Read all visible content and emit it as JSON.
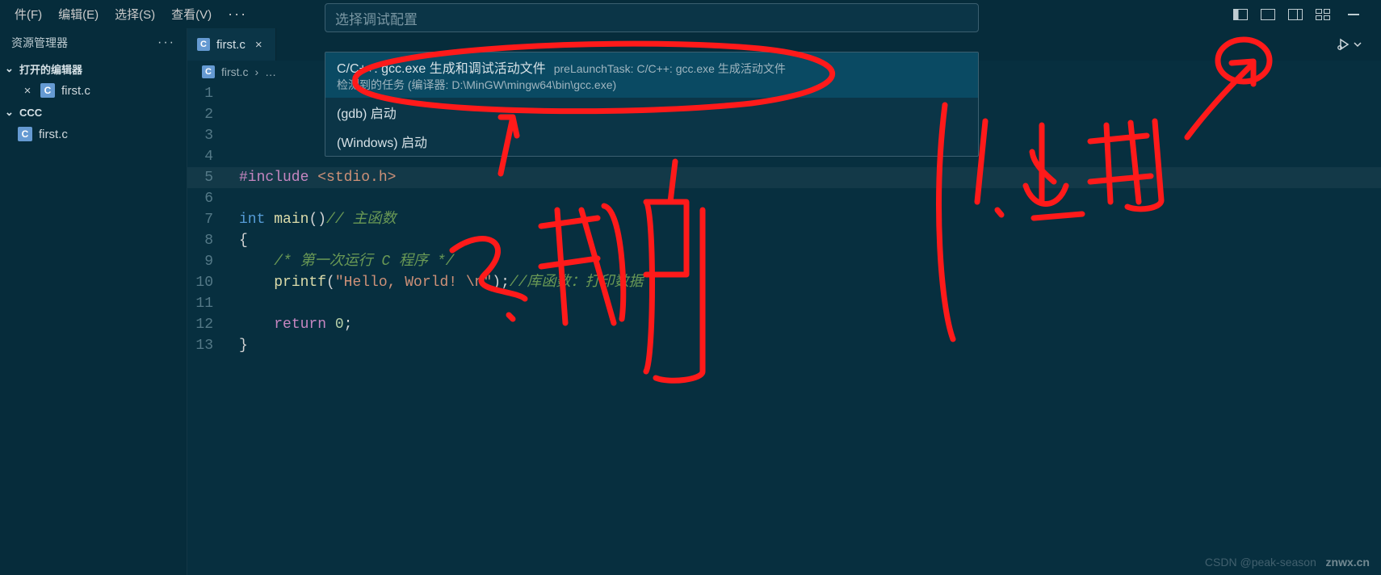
{
  "menubar": {
    "items": [
      "件(F)",
      "编辑(E)",
      "选择(S)",
      "查看(V)"
    ],
    "more": "···"
  },
  "title_controls": {
    "layouts": [
      "layout-left",
      "layout-bottom",
      "layout-right",
      "layout-grid"
    ],
    "minimize": "—"
  },
  "sidebar": {
    "title": "资源管理器",
    "more": "···",
    "open_editors_label": "打开的编辑器",
    "open_file": "first.c",
    "workspace_label": "CCC",
    "workspace_file": "first.c"
  },
  "tab": {
    "label": "first.c",
    "close": "×"
  },
  "run_button": {
    "icon": "debug-play-icon"
  },
  "breadcrumb": {
    "file": "first.c",
    "sep": "›",
    "more": "…"
  },
  "picker": {
    "placeholder": "选择调试配置",
    "items": [
      {
        "title": "C/C++: gcc.exe 生成和调试活动文件",
        "hint": "preLaunchTask: C/C++: gcc.exe 生成活动文件",
        "sub": "检测到的任务 (编译器: D:\\MinGW\\mingw64\\bin\\gcc.exe)"
      },
      {
        "title": "(gdb) 启动"
      },
      {
        "title": "(Windows) 启动"
      }
    ]
  },
  "editor_lines": [
    "1",
    "2",
    "3",
    "4",
    "5",
    "6",
    "7",
    "8",
    "9",
    "10",
    "11",
    "12",
    "13"
  ],
  "code": {
    "l5a": "#include ",
    "l5b": "<stdio.h>",
    "l7a": "int",
    "l7b": " ",
    "l7c": "main",
    "l7d": "()",
    "l7e": "// 主函数",
    "l8": "{",
    "l9": "    /* 第一次运行 C 程序 */",
    "l10a": "    ",
    "l10b": "printf",
    "l10c": "(",
    "l10d": "\"Hello, World! \\n\"",
    "l10e": ");",
    "l10f": "//库函数：打印数据",
    "l12a": "    ",
    "l12b": "return",
    "l12c": " ",
    "l12d": "0",
    "l12e": ";",
    "l13": "}"
  },
  "watermark": {
    "left": "CSDN @peak-season",
    "right": "znwx.cn"
  },
  "annotations": {
    "text1": "2. 选调",
    "text2": "1. 点击"
  }
}
